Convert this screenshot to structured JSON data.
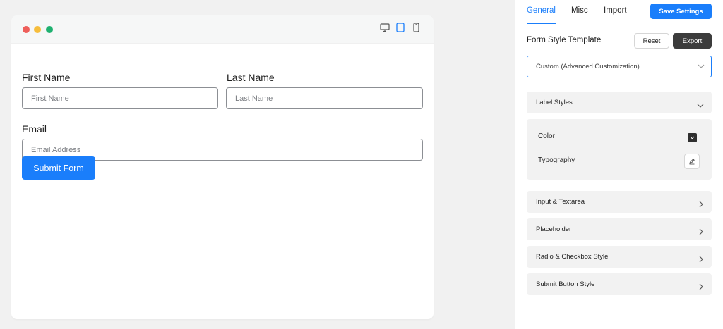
{
  "preview": {
    "window_dots": [
      "red",
      "yellow",
      "green"
    ],
    "device_icons": [
      "desktop-icon",
      "tablet-icon",
      "mobile-icon"
    ],
    "active_device": "tablet",
    "form": {
      "first_name_label": "First Name",
      "first_name_placeholder": "First Name",
      "last_name_label": "Last Name",
      "last_name_placeholder": "Last Name",
      "email_label": "Email",
      "email_placeholder": "Email Address",
      "submit_label": "Submit Form"
    }
  },
  "panel": {
    "tabs": [
      {
        "label": "General",
        "active": true
      },
      {
        "label": "Misc",
        "active": false
      },
      {
        "label": "Import",
        "active": false
      }
    ],
    "save_label": "Save Settings",
    "template_title": "Form Style Template",
    "reset_label": "Reset",
    "export_label": "Export",
    "template_selected": "Custom (Advanced Customization)",
    "sections": [
      {
        "label": "Label Styles",
        "expanded": true
      },
      {
        "label": "Input & Textarea",
        "expanded": false
      },
      {
        "label": "Placeholder",
        "expanded": false
      },
      {
        "label": "Radio & Checkbox Style",
        "expanded": false
      },
      {
        "label": "Submit Button Style",
        "expanded": false
      }
    ],
    "label_styles": {
      "color_label": "Color",
      "color_value": "#2f2f2f",
      "typography_label": "Typography"
    }
  },
  "colors": {
    "accent": "#1a7efb",
    "dark_button": "#3c3c3c",
    "section_bg": "#f2f2f2"
  }
}
